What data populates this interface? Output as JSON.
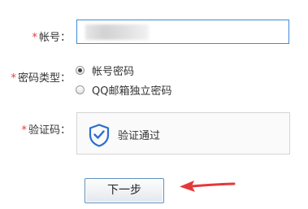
{
  "form": {
    "required_mark": "*",
    "account": {
      "label": "帐号：",
      "value": "",
      "value_masked": true
    },
    "password_type": {
      "label": "密码类型：",
      "options": [
        {
          "label": "帐号密码",
          "checked": true
        },
        {
          "label": "QQ邮箱独立密码",
          "checked": false
        }
      ]
    },
    "captcha": {
      "label": "验证码：",
      "status_text": "验证通过",
      "icon": "shield-check-icon"
    },
    "next_button": {
      "label": "下一步"
    }
  },
  "colors": {
    "required": "#e4393c",
    "input_focus_border": "#3d8bd9",
    "shield": "#2a6fd0",
    "arrow": "#e5383b",
    "button_border": "#5f8fbd"
  }
}
